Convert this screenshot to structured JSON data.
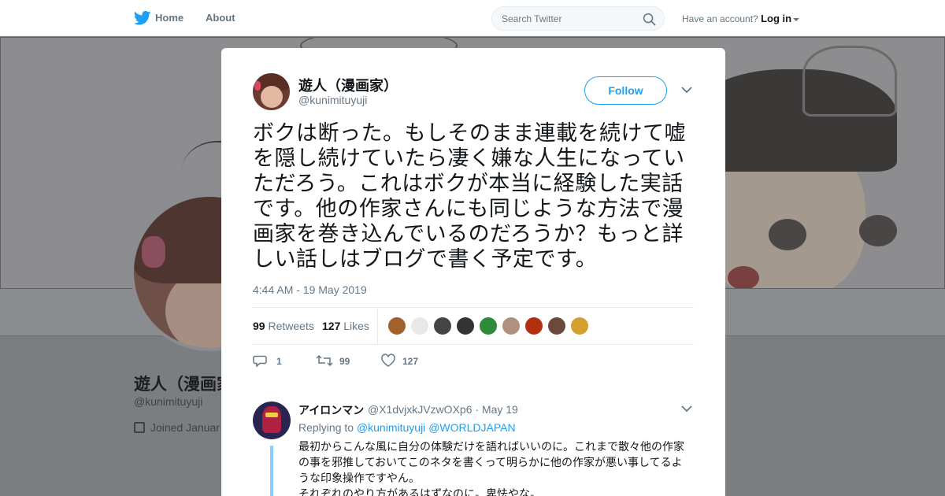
{
  "topbar": {
    "home_label": "Home",
    "about_label": "About",
    "search_placeholder": "Search Twitter",
    "account_prompt": "Have an account?",
    "login_label": "Log in"
  },
  "profile": {
    "name": "遊人（漫画家",
    "handle": "@kunimituyuji",
    "joined": "Joined Januar"
  },
  "tweet": {
    "author_name": "遊人（漫画家）",
    "author_handle": "@kunimituyuji",
    "follow_label": "Follow",
    "text": "ボクは断った。もしそのまま連載を続けて嘘を隠し続けていたら凄く嫌な人生になっていただろう。これはボクが本当に経験した実話です。他の作家さんにも同じような方法で漫画家を巻き込んでいるのだろうか？もっと詳しい話しはブログで書く予定です。",
    "timestamp": "4:44 AM - 19 May 2019",
    "retweets_count": "99",
    "retweets_label": "Retweets",
    "likes_count": "127",
    "likes_label": "Likes",
    "replies_action": "1",
    "retweets_action": "99",
    "likes_action": "127",
    "liker_colors": [
      "#a0622a",
      "#e8e8e8",
      "#444444",
      "#333333",
      "#2e8b3a",
      "#b09080",
      "#b03010",
      "#6a4a3a",
      "#d4a030"
    ]
  },
  "reply": {
    "name": "アイロンマン",
    "handle": "@X1dvjxkJVzwOXp6",
    "dot": "·",
    "date": "May 19",
    "replying_to": "Replying to",
    "mention_1": "@kunimituyuji",
    "mention_2": "@WORLDJAPAN",
    "text": "最初からこんな風に自分の体験だけを語ればいいのに。これまで散々他の作家の事を邪推しておいてこのネタを書くって明らかに他の作家が悪い事してるような印象操作ですやん。\nそれぞれのやり方があるはずなのに。卑怯やな。"
  },
  "colors": {
    "accent": "#1da1f2",
    "text_secondary": "#657786",
    "overlay_bg": "#7a7d80"
  }
}
